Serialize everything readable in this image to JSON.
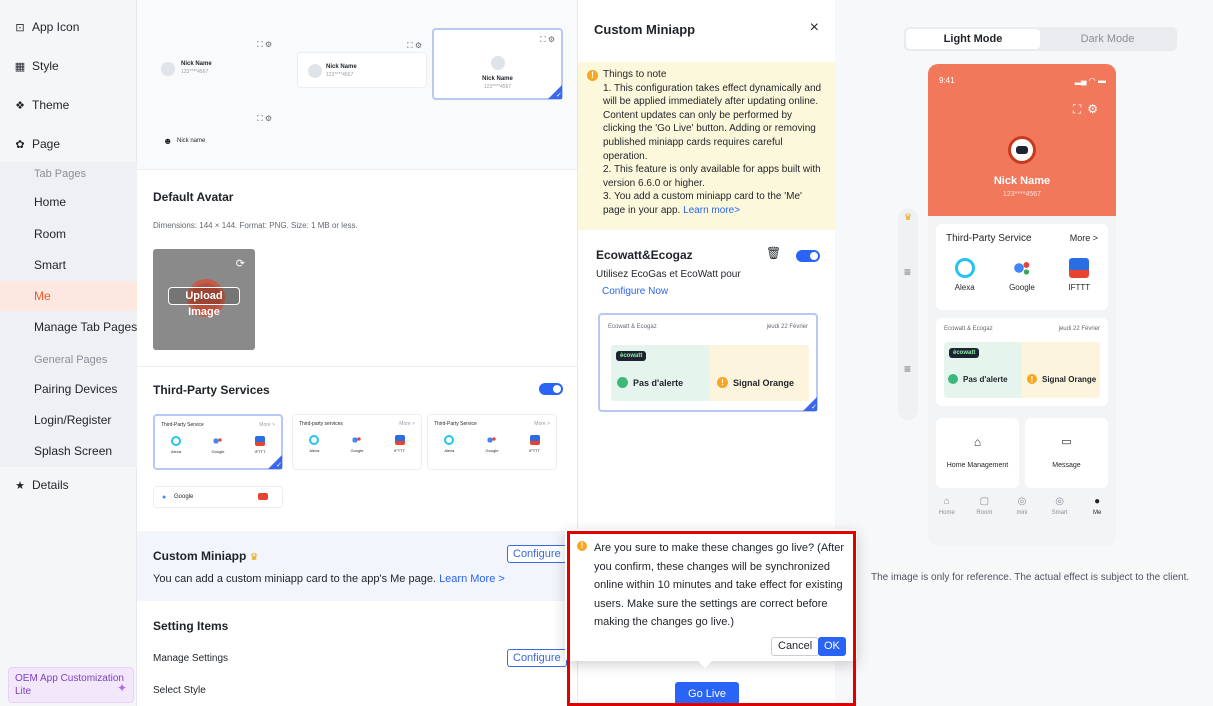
{
  "sidebar": {
    "sections": [
      {
        "icon": "app-icon",
        "label": "App Icon"
      },
      {
        "icon": "style-icon",
        "label": "Style"
      },
      {
        "icon": "theme-icon",
        "label": "Theme"
      },
      {
        "icon": "page-icon",
        "label": "Page"
      }
    ],
    "tab_pages_header": "Tab Pages",
    "tab_pages": [
      "Home",
      "Room",
      "Smart",
      "Me",
      "Manage Tab Pages"
    ],
    "active_tab_page": "Me",
    "general_pages_header": "General Pages",
    "general_pages": [
      "Pairing Devices",
      "Login/Register",
      "Splash Screen"
    ],
    "details": {
      "icon": "star-icon",
      "label": "Details"
    },
    "oem_label": "OEM App Customization Lite"
  },
  "profile_cards": {
    "nick_name": "Nick Name",
    "account": "123****4567",
    "nick_name_small": "Nick name"
  },
  "default_avatar": {
    "title": "Default Avatar",
    "desc": "Dimensions: 144 × 144. Format: PNG. Size: 1 MB or less.",
    "upload_label": "Upload Image"
  },
  "third_party": {
    "title": "Third-Party Services",
    "enabled": true,
    "cards": [
      {
        "head": "Third-Party Service",
        "more": "More >"
      },
      {
        "head": "Third-party services",
        "more": "More >"
      },
      {
        "head": "Third-Party Service",
        "more": "More >"
      }
    ],
    "items": [
      "Alexa",
      "Google",
      "IFTTT"
    ],
    "list_item": "Google"
  },
  "custom_miniapp_section": {
    "title": "Custom Miniapp",
    "desc": "You can add a custom miniapp card to the app's Me page.",
    "learn_more": "Learn More >",
    "configure_label": "Configure"
  },
  "setting_items": {
    "title": "Setting Items",
    "manage": "Manage Settings",
    "configure_label": "Configure",
    "select_style": "Select Style"
  },
  "miniapp_panel": {
    "title": "Custom Miniapp",
    "close": "×",
    "note_title": "Things to note",
    "note_lines": [
      "1. This configuration takes effect dynamically and will be applied immediately after updating online. Content updates can only be performed by clicking the 'Go Live' button. Adding or removing published miniapp cards requires careful operation.",
      "2. This feature is only available for apps built with version 6.6.0 or higher.",
      "3. You add a custom miniapp card to the 'Me' page in your app."
    ],
    "learn_more": "Learn more>",
    "app_name": "Ecowatt&Ecogaz",
    "app_desc": "Utilisez EcoGas et EcoWatt pour",
    "configure_now": "Configure Now",
    "enabled": true,
    "card": {
      "head": "Ecowatt & Ecogaz",
      "date": "jeudi 22 Février",
      "badge": "ècowatt",
      "left_status": "Pas d'alerte",
      "right_status": "Signal Orange"
    }
  },
  "confirm_popover": {
    "message": "Are you sure to make these changes go live? (After you confirm, these changes will be synchronized online within 10 minutes and take effect for existing users. Make sure the settings are correct before making the changes go live.)",
    "cancel": "Cancel",
    "ok": "OK"
  },
  "go_live": "Go Live",
  "preview": {
    "light_mode": "Light Mode",
    "dark_mode": "Dark Mode",
    "active_mode": "Light Mode",
    "time": "9:41",
    "nick_name": "Nick Name",
    "account": "123****4567",
    "third_party_head": "Third-Party Service",
    "more": "More >",
    "services": [
      "Alexa",
      "Google",
      "IFTTT"
    ],
    "eco_head": "Ecowatt & Ecogaz",
    "eco_date": "jeudi 22 Février",
    "eco_badge": "ècowatt",
    "eco_left": "Pas d'alerte",
    "eco_right": "Signal Orange",
    "home_management": "Home Management",
    "message": "Message",
    "tabs": [
      "Home",
      "Room",
      "mini",
      "Smart",
      "Me"
    ],
    "active_tab": "Me",
    "note": "The image is only for reference. The actual effect is subject to the client."
  },
  "colors": {
    "accent": "#2a64f6",
    "brand_orange": "#f2785c",
    "warning": "#f5a623",
    "highlight_box": "#e00000"
  }
}
